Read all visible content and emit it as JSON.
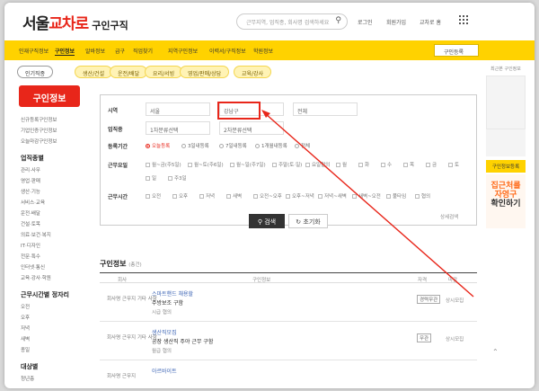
{
  "header": {
    "logo_main": "서울",
    "logo_accent": "교차로",
    "logo_sub": "구인구직",
    "search_placeholder": "근무지역, 업직종, 회사명 검색하세요",
    "links": [
      "로그인",
      "회원가입",
      "교차로 홈"
    ]
  },
  "nav": {
    "items": [
      "인재구직정보",
      "구인정보",
      "알바정보",
      "급구",
      "직업찾기",
      "지역구인정보",
      "이력서/구직정보",
      "학원정보"
    ],
    "active_index": 1,
    "button": "구인등록"
  },
  "tabs": {
    "primary": "인기직종",
    "pills": [
      "생산/건설",
      "운전/배달",
      "요리/서빙",
      "영업/판매/상담",
      "교육/강사"
    ]
  },
  "sidebar": {
    "title": "구인정보",
    "top_items": [
      "신규등록구인정보",
      "기업인증구인정보",
      "오늘마감구인정보"
    ],
    "groups": [
      {
        "head": "업직종별",
        "items": [
          "관리·사무",
          "영업·판매",
          "생산·기능",
          "서비스·교육",
          "운전·배달",
          "건설·토목",
          "의료·보건·복지",
          "IT·디자인",
          "전문·특수",
          "인터넷·통신",
          "교육·강사·학원"
        ]
      },
      {
        "head": "근무시간별 정자리",
        "items": [
          "오전",
          "오후",
          "저녁",
          "새벽",
          "종일"
        ]
      },
      {
        "head": "대상별",
        "items": [
          "청년층"
        ]
      }
    ]
  },
  "filter": {
    "region_label": "시역",
    "region_values": [
      "서울",
      "강남구",
      "전체"
    ],
    "job_label": "업직종",
    "job_values": [
      "1차분류선택",
      "2차분류선택"
    ],
    "period_label": "등록기간",
    "period_options": [
      "오늘등록",
      "3일내등록",
      "7일내등록",
      "1개월내등록",
      "전체"
    ],
    "workform_label": "근무요일",
    "workform_options": [
      "월~금(주5일)",
      "월~토(주6일)",
      "월~일(주7일)",
      "주말(토·일)",
      "요일협의",
      "월",
      "화",
      "수",
      "목",
      "금",
      "토",
      "일",
      "주3일"
    ],
    "worktime_label": "근무시간",
    "worktime_options": [
      "오전",
      "오후",
      "저녁",
      "새벽",
      "오전~오후",
      "오후~저녁",
      "저녁~새벽",
      "새벽~오전",
      "풀타임",
      "협의"
    ],
    "search_btn": "검색",
    "reset_btn": "초기화",
    "detail_link": "상세검색"
  },
  "list": {
    "title": "구인정보",
    "count": "(총건)",
    "columns": [
      "회사",
      "구인정보",
      "자격",
      "마감"
    ],
    "rows": [
      {
        "who": "회사명 근무지 기타 사항",
        "ttl": "스마트핸드 채용할",
        "desc": "주방보조 구함",
        "meta": "시급 협의",
        "tag": "경력무관",
        "due": "상시모집"
      },
      {
        "who": "회사명 근무지 기타 사항",
        "ttl": "생산직모집",
        "desc": "공장 생산직 주야 근무 구함",
        "meta": "월급 협의",
        "tag": "무관",
        "due": "상시모집"
      },
      {
        "who": "회사명 근무지",
        "ttl": "아르바이트",
        "desc": "",
        "meta": "",
        "tag": "",
        "due": ""
      }
    ]
  },
  "rail": {
    "title": "최근본 구인정보",
    "yellow_btn": "구인정보등록",
    "banner_line1": "집근처를",
    "banner_line2": "자영구",
    "banner_line3": "확인하기"
  },
  "colors": {
    "accent": "#ffd200",
    "brand_red": "#e8261a",
    "arrow": "#e8261a"
  }
}
